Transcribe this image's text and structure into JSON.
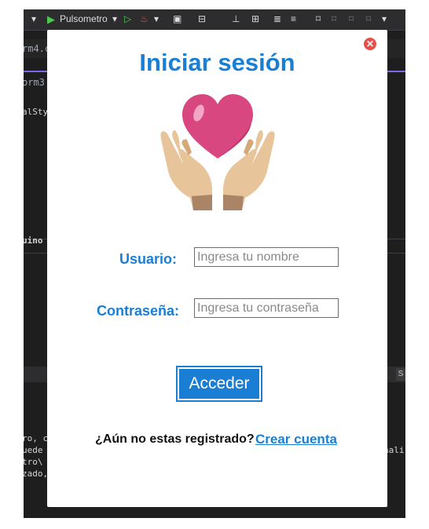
{
  "ide": {
    "toolbar": {
      "project_name": "Pulsometro"
    },
    "tab_labels": [
      "rm4.c",
      "orm3"
    ],
    "code_fragments": [
      "alSty",
      "uino",
      "ro, c",
      "uede",
      "tro\\",
      "zado,",
      "nali"
    ],
    "side_tab_label": "S"
  },
  "dialog": {
    "title": "Iniciar sesión",
    "logo_icon": "heart-hands-icon",
    "username": {
      "label": "Usuario:",
      "placeholder": "Ingresa tu nombre",
      "value": ""
    },
    "password": {
      "label": "Contraseña:",
      "placeholder": "Ingresa tu contraseña",
      "value": ""
    },
    "submit_label": "Acceder",
    "footer_text": "¿Aún no estas registrado?",
    "register_link": "Crear cuenta",
    "close_icon": "close-icon"
  },
  "colors": {
    "accent": "#1a7fd4",
    "close": "#e8514a",
    "heart": "#e0508a",
    "hands": "#e8c49a"
  }
}
